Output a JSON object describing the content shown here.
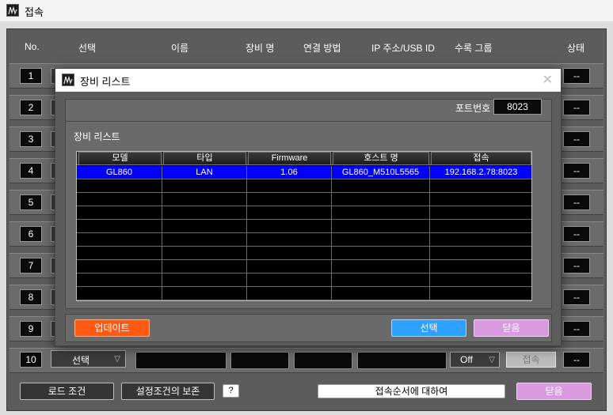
{
  "window": {
    "title": "접속"
  },
  "columns": [
    "No.",
    "선택",
    "이름",
    "장비 명",
    "연결 방법",
    "IP 주소/USB ID",
    "수록 그룹",
    "상태"
  ],
  "rows": [
    {
      "no": "1",
      "status": "--"
    },
    {
      "no": "2",
      "status": "--"
    },
    {
      "no": "3",
      "status": "--"
    },
    {
      "no": "4",
      "status": "--"
    },
    {
      "no": "5",
      "status": "--"
    },
    {
      "no": "6",
      "status": "--"
    },
    {
      "no": "7",
      "status": "--"
    },
    {
      "no": "8",
      "status": "--"
    },
    {
      "no": "9",
      "status": "--"
    },
    {
      "no": "10",
      "status": "--",
      "select": "선택",
      "mode": "Off",
      "connect": "접속"
    }
  ],
  "footer": {
    "load_button": "로드 조건",
    "save_button": "설정조건의 보존",
    "help_button": "?",
    "info_button": "접속순서에 대하여",
    "close_button": "닫음"
  },
  "dialog": {
    "title": "장비 리스트",
    "port_label": "포트번호",
    "port_value": "8023",
    "list_label": "장비 리스트",
    "table": {
      "headers": [
        "모델",
        "타입",
        "Firmware",
        "호스트 명",
        "접속"
      ],
      "rows": [
        [
          "GL860",
          "LAN",
          "1.06",
          "GL860_M510L5565",
          "192.168.2.78:8023"
        ]
      ]
    },
    "update_button": "업데이트",
    "select_button": "선택",
    "close_button": "닫음"
  },
  "colors": {
    "selection": "#0000ff",
    "update_button": "#ff5a14",
    "select_button": "#2ea0ff",
    "close_button": "#d99be0"
  }
}
